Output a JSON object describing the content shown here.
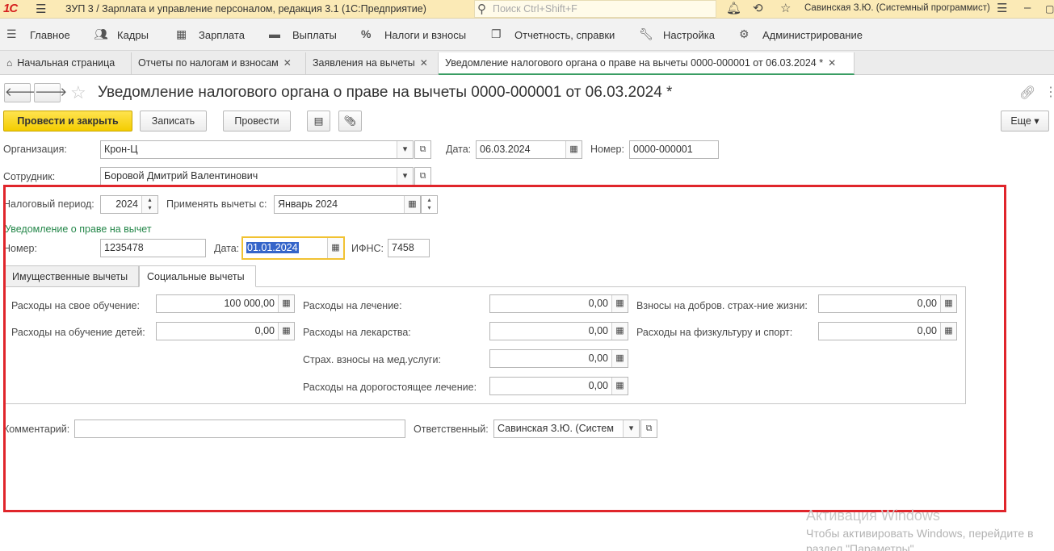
{
  "titlebar": {
    "logo": "1С",
    "title": "ЗУП 3 / Зарплата и управление персоналом, редакция 3.1  (1С:Предприятие)",
    "search_placeholder": "Поиск Ctrl+Shift+F",
    "user": "Савинская З.Ю. (Системный программист)",
    "icons": [
      "menu-icon",
      "search-icon",
      "bell-icon",
      "history-icon",
      "star-icon",
      "settings-icon",
      "minimize-icon",
      "maximize-icon"
    ]
  },
  "sections": [
    {
      "label": "Главное",
      "icon": "menu-icon"
    },
    {
      "label": "Кадры",
      "icon": "people-icon"
    },
    {
      "label": "Зарплата",
      "icon": "calculator-icon"
    },
    {
      "label": "Выплаты",
      "icon": "wallet-icon"
    },
    {
      "label": "Налоги и взносы",
      "icon": "percent-icon"
    },
    {
      "label": "Отчетность, справки",
      "icon": "reports-icon"
    },
    {
      "label": "Настройка",
      "icon": "wrench-icon"
    },
    {
      "label": "Администрирование",
      "icon": "gear-icon"
    }
  ],
  "tabs": [
    {
      "label": "Начальная страница",
      "icon": "home-icon"
    },
    {
      "label": "Отчеты по налогам и взносам"
    },
    {
      "label": "Заявления на вычеты"
    },
    {
      "label": "Уведомление налогового органа о праве на вычеты 0000-000001 от 06.03.2024 *"
    }
  ],
  "form": {
    "title": "Уведомление налогового органа о праве на вычеты 0000-000001 от 06.03.2024 *",
    "buttons": {
      "post_close": "Провести и закрыть",
      "save": "Записать",
      "post": "Провести",
      "more": "Еще"
    },
    "organization": {
      "label": "Организация:",
      "value": "Крон-Ц"
    },
    "date": {
      "label": "Дата:",
      "value": "06.03.2024"
    },
    "number": {
      "label": "Номер:",
      "value": "0000-000001"
    },
    "employee": {
      "label": "Сотрудник:",
      "value": "Боровой Дмитрий Валентинович"
    },
    "tax_period": {
      "label": "Налоговый период:",
      "value": "2024"
    },
    "apply_from": {
      "label": "Применять вычеты с:",
      "value": "Январь 2024"
    },
    "notice_header": "Уведомление о праве на вычет",
    "notice_number": {
      "label": "Номер:",
      "value": "1235478"
    },
    "notice_date": {
      "label": "Дата:",
      "value": "01.01.2024"
    },
    "ifns": {
      "label": "ИФНС:",
      "value": "7458"
    },
    "inner_tabs": [
      "Имущественные вычеты",
      "Социальные вычеты"
    ],
    "social": {
      "own_education": {
        "label": "Расходы на свое обучение:",
        "value": "100 000,00"
      },
      "children_education": {
        "label": "Расходы на обучение детей:",
        "value": "0,00"
      },
      "treatment": {
        "label": "Расходы на лечение:",
        "value": "0,00"
      },
      "medicines": {
        "label": "Расходы на лекарства:",
        "value": "0,00"
      },
      "med_insurance": {
        "label": "Страх. взносы на мед.услуги:",
        "value": "0,00"
      },
      "expensive_treatment": {
        "label": "Расходы на дорогостоящее лечение:",
        "value": "0,00"
      },
      "life_insurance": {
        "label": "Взносы на добров. страх-ние жизни:",
        "value": "0,00"
      },
      "sport": {
        "label": "Расходы на физкультуру и спорт:",
        "value": "0,00"
      }
    },
    "comment": {
      "label": "Комментарий:",
      "value": ""
    },
    "responsible": {
      "label": "Ответственный:",
      "value": "Савинская З.Ю. (Систем"
    }
  },
  "watermark": {
    "line1": "Активация Windows",
    "line2": "Чтобы активировать Windows, перейдите в",
    "line3": "раздел \"Параметры\"."
  },
  "colors": {
    "accent_yellow": "#f4cd00",
    "highlight_red": "#e0252b",
    "group_green": "#25874a"
  }
}
